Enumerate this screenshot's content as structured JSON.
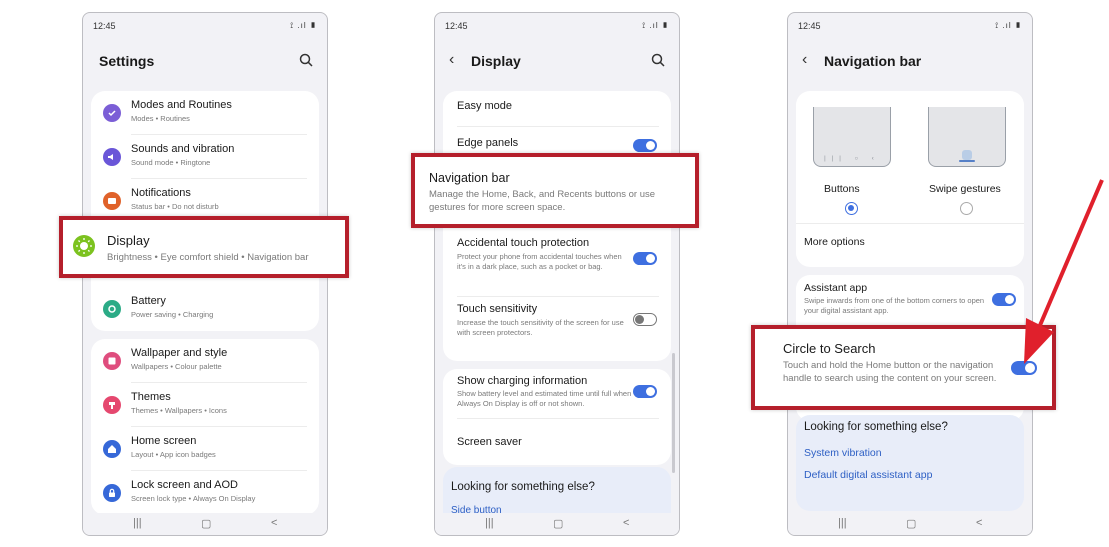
{
  "status": {
    "time": "12:45",
    "icons": "⟟ .ıl ▮"
  },
  "phone1": {
    "title": "Settings",
    "items": [
      {
        "title": "Modes and Routines",
        "sub": "Modes • Routines",
        "color": "#7b5ed6"
      },
      {
        "title": "Sounds and vibration",
        "sub": "Sound mode • Ringtone",
        "color": "#6a56d8"
      },
      {
        "title": "Notifications",
        "sub": "Status bar • Do not disturb",
        "color": "#e0622a"
      },
      {
        "title": "Display",
        "sub": "Brightness • Eye comfort shield • Navigation bar",
        "color": "#7cc21f"
      },
      {
        "title": "Battery",
        "sub": "Power saving • Charging",
        "color": "#2bab86"
      },
      {
        "title": "Wallpaper and style",
        "sub": "Wallpapers • Colour palette",
        "color": "#df4d7e"
      },
      {
        "title": "Themes",
        "sub": "Themes • Wallpapers • Icons",
        "color": "#e5486f"
      },
      {
        "title": "Home screen",
        "sub": "Layout • App icon badges",
        "color": "#3668d8"
      },
      {
        "title": "Lock screen and AOD",
        "sub": "Screen lock type • Always On Display",
        "color": "#3668d8"
      }
    ]
  },
  "phone2": {
    "title": "Display",
    "easy_mode": "Easy mode",
    "edge_panels": "Edge panels",
    "nav_bar": {
      "title": "Navigation bar",
      "sub": "Manage the Home, Back, and Recents buttons or use gestures for more screen space."
    },
    "accidental": {
      "title": "Accidental touch protection",
      "sub": "Protect your phone from accidental touches when it's in a dark place, such as a pocket or bag."
    },
    "touch": {
      "title": "Touch sensitivity",
      "sub": "Increase the touch sensitivity of the screen for use with screen protectors."
    },
    "charging": {
      "title": "Show charging information",
      "sub": "Show battery level and estimated time until full when Always On Display is off or not shown."
    },
    "screen_saver": "Screen saver",
    "looking": "Looking for something else?",
    "peek": "Side button"
  },
  "phone3": {
    "title": "Navigation bar",
    "buttons": "Buttons",
    "swipe": "Swipe gestures",
    "more_options": "More options",
    "assistant": {
      "title": "Assistant app",
      "sub": "Swipe inwards from one of the bottom corners to open your digital assistant app."
    },
    "cts": {
      "title": "Circle to Search",
      "sub": "Touch and hold the Home button or the navigation handle to search using the content on your screen."
    },
    "looking": "Looking for something else?",
    "link1": "System vibration",
    "link2": "Default digital assistant app"
  },
  "nav": {
    "recents": "|||",
    "home": "▢",
    "back": "<"
  },
  "accent": "#3e6fe0",
  "highlight_color": "#b51f2b"
}
